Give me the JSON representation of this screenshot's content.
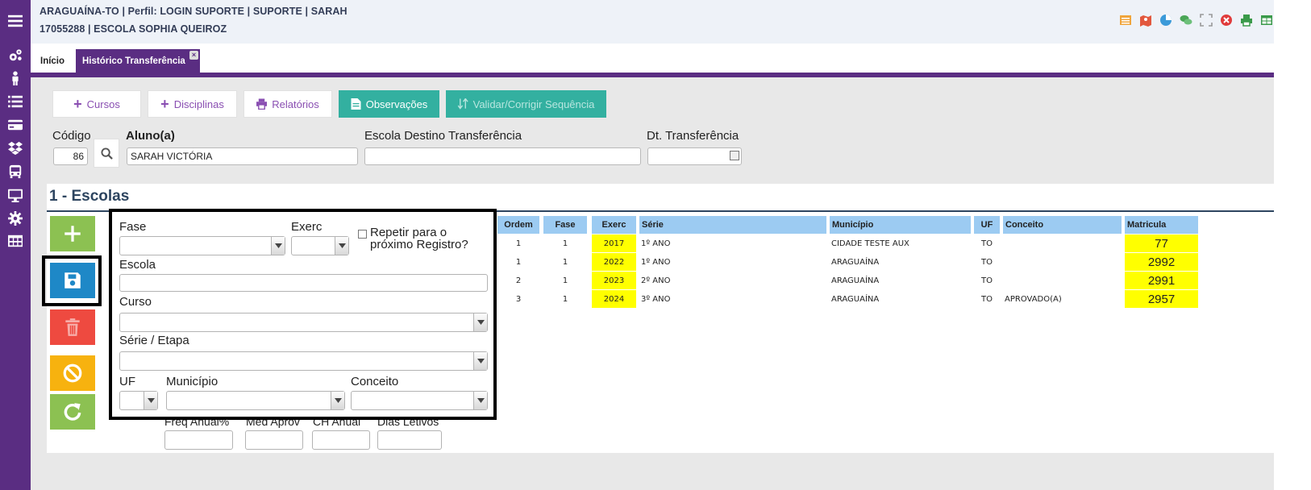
{
  "header": {
    "line1": "ARAGUAÍNA-TO | Perfil: LOGIN SUPORTE | SUPORTE | SARAH",
    "line2": "17055288 | ESCOLA SOPHIA QUEIROZ",
    "icons": [
      "list-icon",
      "map-icon",
      "pie-chart-icon",
      "chat-icon",
      "fullscreen-icon",
      "close-circle-icon",
      "print-icon",
      "table-icon"
    ]
  },
  "sidebar": {
    "icons": [
      "menu-icon",
      "gears-icon",
      "user-icon",
      "list-icon",
      "card-icon",
      "dropbox-icon",
      "bus-icon",
      "monitor-icon",
      "settings-icon",
      "grid-icon"
    ]
  },
  "tabs": [
    {
      "label": "Início",
      "active": false
    },
    {
      "label": "Histórico Transferência",
      "active": true
    }
  ],
  "toolbar": {
    "cursos": "Cursos",
    "disciplinas": "Disciplinas",
    "relatorios": "Relatórios",
    "observacoes": "Observações",
    "validar": "Validar/Corrigir Sequência"
  },
  "form_top": {
    "codigo_label": "Código",
    "codigo_value": "86",
    "aluno_label": "Aluno(a)",
    "aluno_value": "SARAH VICTÓRIA",
    "escola_destino_label": "Escola Destino Transferência",
    "escola_destino_value": "",
    "dt_transferencia_label": "Dt. Transferência",
    "dt_transferencia_value": ""
  },
  "section": {
    "title": "1 - Escolas"
  },
  "record_form": {
    "fase_label": "Fase",
    "exerc_label": "Exerc",
    "repetir_label": "Repetir para o próximo Registro?",
    "escola_label": "Escola",
    "curso_label": "Curso",
    "serie_label": "Série / Etapa",
    "uf_label": "UF",
    "municipio_label": "Município",
    "conceito_label": "Conceito",
    "freq_label": "Freq Anual%",
    "med_label": "Med Aprov",
    "ch_label": "CH Anual",
    "dias_label": "Dias Letivos"
  },
  "table": {
    "headers": {
      "ordem": "Ordem",
      "fase": "Fase",
      "exerc": "Exerc",
      "serie": "Série",
      "municipio": "Município",
      "uf": "UF",
      "conceito": "Conceito",
      "matricula": "Matricula"
    },
    "rows": [
      {
        "ordem": "1",
        "fase": "1",
        "exerc": "2017",
        "serie": "1º ANO",
        "municipio": "CIDADE TESTE AUX",
        "uf": "TO",
        "conceito": "",
        "matricula": "77"
      },
      {
        "ordem": "1",
        "fase": "1",
        "exerc": "2022",
        "serie": "1º ANO",
        "municipio": "ARAGUAÍNA",
        "uf": "TO",
        "conceito": "",
        "matricula": "2992"
      },
      {
        "ordem": "2",
        "fase": "1",
        "exerc": "2023",
        "serie": "2º ANO",
        "municipio": "ARAGUAÍNA",
        "uf": "TO",
        "conceito": "",
        "matricula": "2991"
      },
      {
        "ordem": "3",
        "fase": "1",
        "exerc": "2024",
        "serie": "3º ANO",
        "municipio": "ARAGUAÍNA",
        "uf": "TO",
        "conceito": "APROVADO(A)",
        "matricula": "2957"
      }
    ]
  },
  "colors": {
    "brand_purple": "#5a2d82",
    "teal": "#33b0a0",
    "header_blue": "#9ccbf2",
    "highlight_yellow": "#ffff00"
  }
}
